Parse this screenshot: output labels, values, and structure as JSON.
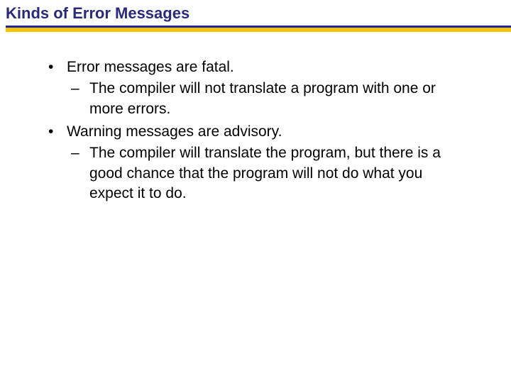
{
  "title": "Kinds of Error Messages",
  "bullets": [
    {
      "text": "Error messages are fatal.",
      "sub": [
        "The compiler will not translate a program with one or more errors."
      ]
    },
    {
      "text": "Warning messages are advisory.",
      "sub": [
        "The compiler will translate the program, but there is a good chance that the program will not do what you expect it to do."
      ]
    }
  ]
}
